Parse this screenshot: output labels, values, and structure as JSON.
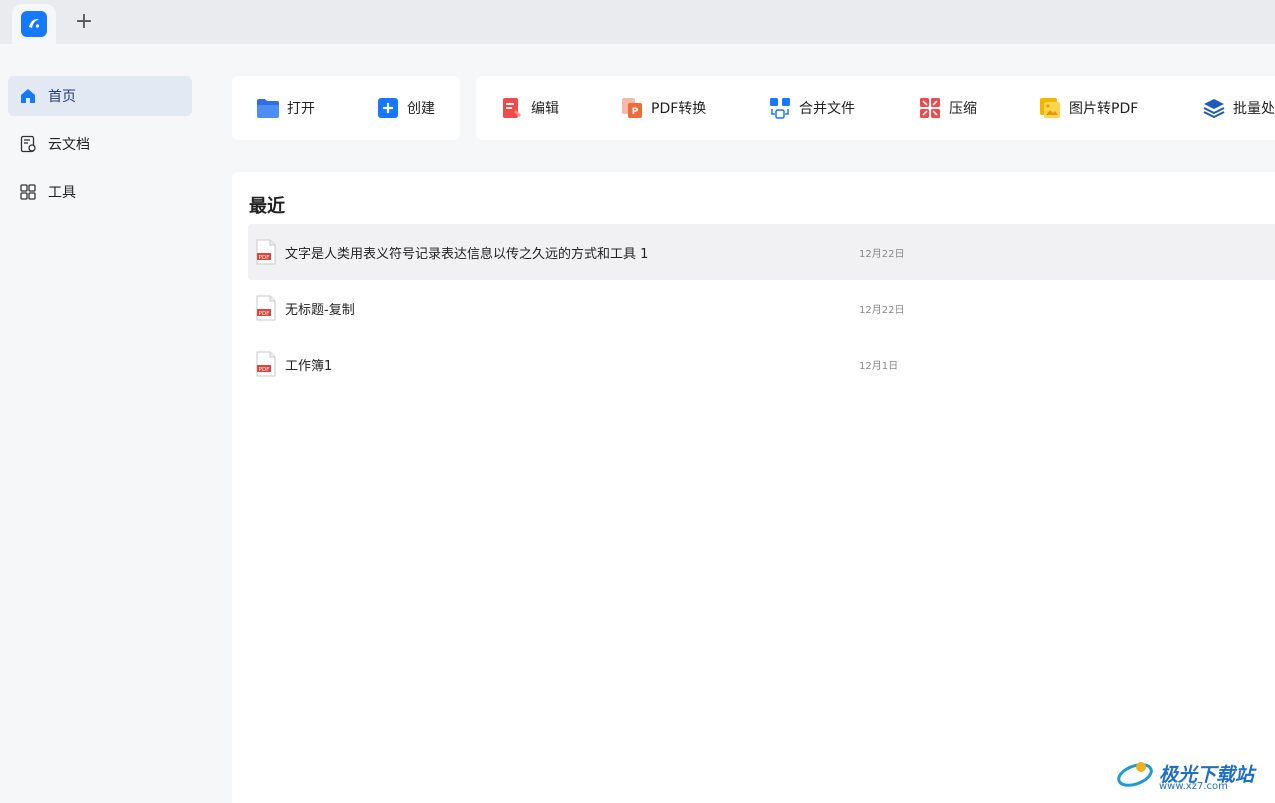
{
  "tabbar": {
    "new_tab_label": "+"
  },
  "sidebar": {
    "items": [
      {
        "label": "首页",
        "active": true
      },
      {
        "label": "云文档",
        "active": false
      },
      {
        "label": "工具",
        "active": false
      }
    ]
  },
  "quick_actions": [
    {
      "label": "打开",
      "icon": "folder-icon"
    },
    {
      "label": "创建",
      "icon": "plus-square-icon"
    }
  ],
  "tools": [
    {
      "label": "编辑",
      "icon": "edit-doc-icon"
    },
    {
      "label": "PDF转换",
      "icon": "pdf-convert-icon"
    },
    {
      "label": "合并文件",
      "icon": "merge-icon"
    },
    {
      "label": "压缩",
      "icon": "compress-icon"
    },
    {
      "label": "图片转PDF",
      "icon": "image-icon"
    },
    {
      "label": "批量处",
      "icon": "layers-icon"
    }
  ],
  "recent": {
    "title": "最近",
    "files": [
      {
        "name": "文字是人类用表义符号记录表达信息以传之久远的方式和工具 1",
        "date": "12月22日",
        "type_label": "PDF"
      },
      {
        "name": "无标题-复制",
        "date": "12月22日",
        "type_label": "PDF"
      },
      {
        "name": "工作簿1",
        "date": "12月1日",
        "type_label": "PDF"
      }
    ]
  },
  "watermark": {
    "text": "极光下载站",
    "url_text": "www.xz7.com"
  },
  "colors": {
    "accent": "#1677ff",
    "pdf_red": "#e0443a"
  }
}
